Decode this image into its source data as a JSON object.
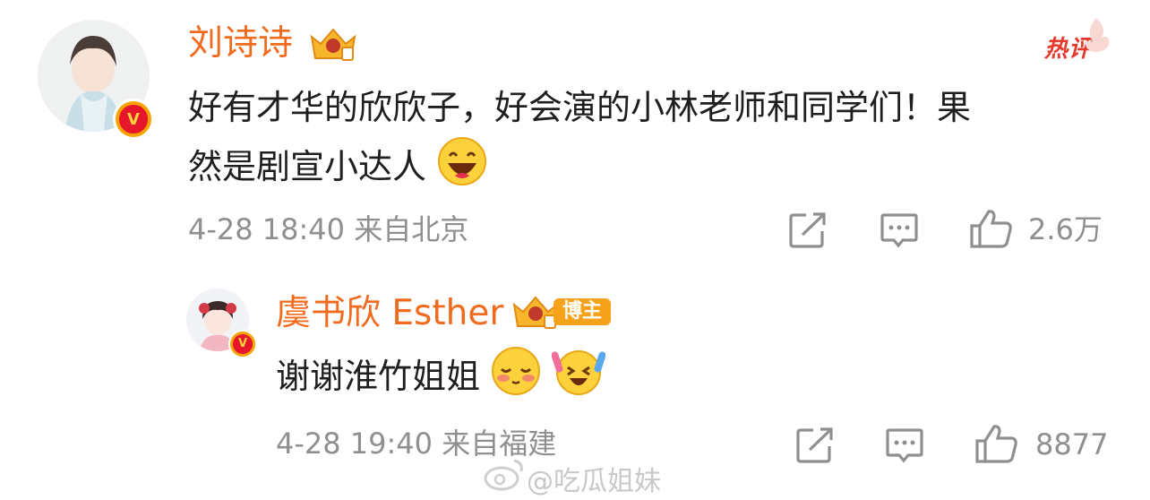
{
  "comment": {
    "author": "刘诗诗",
    "text_line1": "好有才华的欣欣子，好会演的小林老师和同学们！果",
    "text_line2": "然是剧宣小达人",
    "meta": "4-28 18:40 来自北京",
    "like_count": "2.6万",
    "hot_label": "热评",
    "verified_mark": "V",
    "icons": [
      "crown-badge-icon",
      "share-icon",
      "comment-icon",
      "like-icon",
      "laugh-emoji"
    ]
  },
  "reply": {
    "author": "虞书欣 Esther",
    "role_badge": "博主",
    "text": "谢谢淮竹姐姐",
    "meta": "4-28 19:40 来自福建",
    "like_count": "8877",
    "verified_mark": "V",
    "icons": [
      "crown-badge-icon",
      "share-icon",
      "comment-icon",
      "like-icon",
      "shy-emoji",
      "excited-emoji"
    ]
  },
  "watermark": "@吃瓜姐妹",
  "colors": {
    "name": "#f06b1d",
    "meta": "#8f8f8f",
    "badge": "#f6a21a",
    "hot": "#e6382b"
  }
}
